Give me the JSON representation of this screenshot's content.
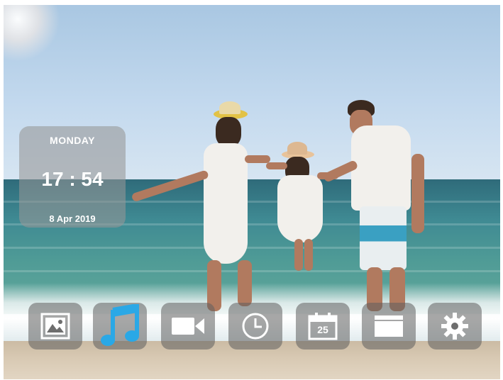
{
  "clock": {
    "day": "MONDAY",
    "time": "17 : 54",
    "date": "8 Apr 2019"
  },
  "dock": {
    "items": [
      {
        "name": "photos",
        "icon": "photo-icon"
      },
      {
        "name": "music",
        "icon": "music-note-icon",
        "active": true
      },
      {
        "name": "video",
        "icon": "video-camera-icon"
      },
      {
        "name": "clock",
        "icon": "clock-icon"
      },
      {
        "name": "calendar",
        "icon": "calendar-icon",
        "label": "25"
      },
      {
        "name": "files",
        "icon": "folder-icon"
      },
      {
        "name": "settings",
        "icon": "gear-icon"
      }
    ]
  },
  "colors": {
    "active_icon": "#2aa8e6",
    "icon": "#ffffff",
    "widget_bg": "rgba(150,150,150,0.58)"
  }
}
